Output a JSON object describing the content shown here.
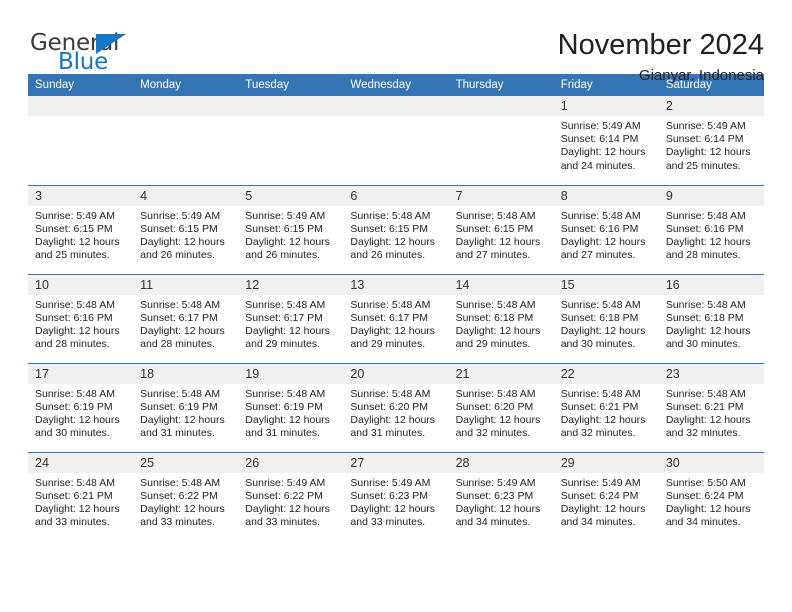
{
  "logo": {
    "word1": "General",
    "word2": "Blue",
    "triangle_color": "#1577c4"
  },
  "header": {
    "title": "November 2024",
    "subtitle": "Gianyar, Indonesia",
    "accent_color": "#3575b5",
    "daynum_band_color": "#f0f0f0"
  },
  "columns": [
    "Sunday",
    "Monday",
    "Tuesday",
    "Wednesday",
    "Thursday",
    "Friday",
    "Saturday"
  ],
  "weeks": [
    [
      {
        "day": "",
        "empty": true
      },
      {
        "day": "",
        "empty": true
      },
      {
        "day": "",
        "empty": true
      },
      {
        "day": "",
        "empty": true
      },
      {
        "day": "",
        "empty": true
      },
      {
        "day": "1",
        "sunrise": "Sunrise: 5:49 AM",
        "sunset": "Sunset: 6:14 PM",
        "daylight": "Daylight: 12 hours and 24 minutes."
      },
      {
        "day": "2",
        "sunrise": "Sunrise: 5:49 AM",
        "sunset": "Sunset: 6:14 PM",
        "daylight": "Daylight: 12 hours and 25 minutes."
      }
    ],
    [
      {
        "day": "3",
        "sunrise": "Sunrise: 5:49 AM",
        "sunset": "Sunset: 6:15 PM",
        "daylight": "Daylight: 12 hours and 25 minutes."
      },
      {
        "day": "4",
        "sunrise": "Sunrise: 5:49 AM",
        "sunset": "Sunset: 6:15 PM",
        "daylight": "Daylight: 12 hours and 26 minutes."
      },
      {
        "day": "5",
        "sunrise": "Sunrise: 5:49 AM",
        "sunset": "Sunset: 6:15 PM",
        "daylight": "Daylight: 12 hours and 26 minutes."
      },
      {
        "day": "6",
        "sunrise": "Sunrise: 5:48 AM",
        "sunset": "Sunset: 6:15 PM",
        "daylight": "Daylight: 12 hours and 26 minutes."
      },
      {
        "day": "7",
        "sunrise": "Sunrise: 5:48 AM",
        "sunset": "Sunset: 6:15 PM",
        "daylight": "Daylight: 12 hours and 27 minutes."
      },
      {
        "day": "8",
        "sunrise": "Sunrise: 5:48 AM",
        "sunset": "Sunset: 6:16 PM",
        "daylight": "Daylight: 12 hours and 27 minutes."
      },
      {
        "day": "9",
        "sunrise": "Sunrise: 5:48 AM",
        "sunset": "Sunset: 6:16 PM",
        "daylight": "Daylight: 12 hours and 28 minutes."
      }
    ],
    [
      {
        "day": "10",
        "sunrise": "Sunrise: 5:48 AM",
        "sunset": "Sunset: 6:16 PM",
        "daylight": "Daylight: 12 hours and 28 minutes."
      },
      {
        "day": "11",
        "sunrise": "Sunrise: 5:48 AM",
        "sunset": "Sunset: 6:17 PM",
        "daylight": "Daylight: 12 hours and 28 minutes."
      },
      {
        "day": "12",
        "sunrise": "Sunrise: 5:48 AM",
        "sunset": "Sunset: 6:17 PM",
        "daylight": "Daylight: 12 hours and 29 minutes."
      },
      {
        "day": "13",
        "sunrise": "Sunrise: 5:48 AM",
        "sunset": "Sunset: 6:17 PM",
        "daylight": "Daylight: 12 hours and 29 minutes."
      },
      {
        "day": "14",
        "sunrise": "Sunrise: 5:48 AM",
        "sunset": "Sunset: 6:18 PM",
        "daylight": "Daylight: 12 hours and 29 minutes."
      },
      {
        "day": "15",
        "sunrise": "Sunrise: 5:48 AM",
        "sunset": "Sunset: 6:18 PM",
        "daylight": "Daylight: 12 hours and 30 minutes."
      },
      {
        "day": "16",
        "sunrise": "Sunrise: 5:48 AM",
        "sunset": "Sunset: 6:18 PM",
        "daylight": "Daylight: 12 hours and 30 minutes."
      }
    ],
    [
      {
        "day": "17",
        "sunrise": "Sunrise: 5:48 AM",
        "sunset": "Sunset: 6:19 PM",
        "daylight": "Daylight: 12 hours and 30 minutes."
      },
      {
        "day": "18",
        "sunrise": "Sunrise: 5:48 AM",
        "sunset": "Sunset: 6:19 PM",
        "daylight": "Daylight: 12 hours and 31 minutes."
      },
      {
        "day": "19",
        "sunrise": "Sunrise: 5:48 AM",
        "sunset": "Sunset: 6:19 PM",
        "daylight": "Daylight: 12 hours and 31 minutes."
      },
      {
        "day": "20",
        "sunrise": "Sunrise: 5:48 AM",
        "sunset": "Sunset: 6:20 PM",
        "daylight": "Daylight: 12 hours and 31 minutes."
      },
      {
        "day": "21",
        "sunrise": "Sunrise: 5:48 AM",
        "sunset": "Sunset: 6:20 PM",
        "daylight": "Daylight: 12 hours and 32 minutes."
      },
      {
        "day": "22",
        "sunrise": "Sunrise: 5:48 AM",
        "sunset": "Sunset: 6:21 PM",
        "daylight": "Daylight: 12 hours and 32 minutes."
      },
      {
        "day": "23",
        "sunrise": "Sunrise: 5:48 AM",
        "sunset": "Sunset: 6:21 PM",
        "daylight": "Daylight: 12 hours and 32 minutes."
      }
    ],
    [
      {
        "day": "24",
        "sunrise": "Sunrise: 5:48 AM",
        "sunset": "Sunset: 6:21 PM",
        "daylight": "Daylight: 12 hours and 33 minutes."
      },
      {
        "day": "25",
        "sunrise": "Sunrise: 5:48 AM",
        "sunset": "Sunset: 6:22 PM",
        "daylight": "Daylight: 12 hours and 33 minutes."
      },
      {
        "day": "26",
        "sunrise": "Sunrise: 5:49 AM",
        "sunset": "Sunset: 6:22 PM",
        "daylight": "Daylight: 12 hours and 33 minutes."
      },
      {
        "day": "27",
        "sunrise": "Sunrise: 5:49 AM",
        "sunset": "Sunset: 6:23 PM",
        "daylight": "Daylight: 12 hours and 33 minutes."
      },
      {
        "day": "28",
        "sunrise": "Sunrise: 5:49 AM",
        "sunset": "Sunset: 6:23 PM",
        "daylight": "Daylight: 12 hours and 34 minutes."
      },
      {
        "day": "29",
        "sunrise": "Sunrise: 5:49 AM",
        "sunset": "Sunset: 6:24 PM",
        "daylight": "Daylight: 12 hours and 34 minutes."
      },
      {
        "day": "30",
        "sunrise": "Sunrise: 5:50 AM",
        "sunset": "Sunset: 6:24 PM",
        "daylight": "Daylight: 12 hours and 34 minutes."
      }
    ]
  ]
}
